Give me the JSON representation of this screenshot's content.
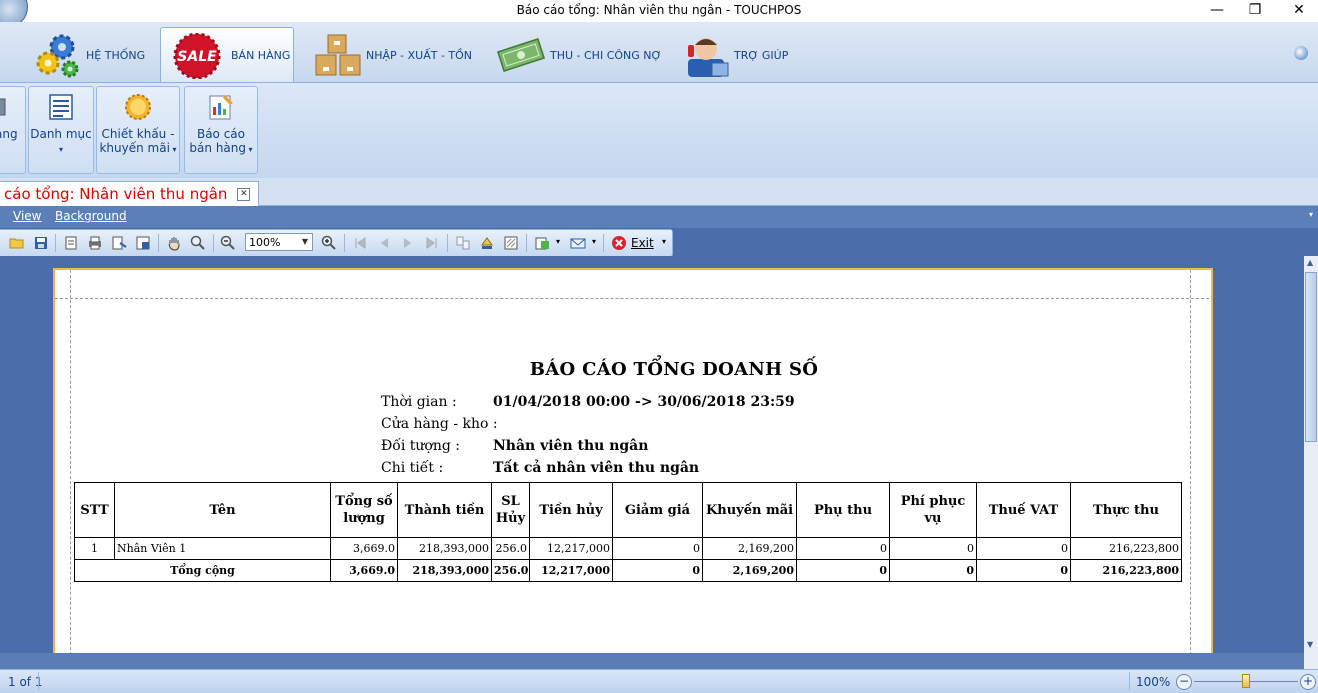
{
  "window": {
    "title": "Báo cáo tổng: Nhân viên thu ngân - TOUCHPOS",
    "minimize": "—",
    "maximize": "❐",
    "close": "✕"
  },
  "ribbon_tabs": [
    {
      "label": "HỆ THỐNG",
      "icon": "gears-icon"
    },
    {
      "label": "BÁN HÀNG",
      "icon": "sale-badge-icon",
      "badge": "SALE"
    },
    {
      "label": "NHẬP - XUẤT - TỒN",
      "icon": "boxes-icon"
    },
    {
      "label": "THU - CHI CÔNG NỢ",
      "icon": "money-icon"
    },
    {
      "label": "TRỢ GIÚP",
      "icon": "support-agent-icon"
    }
  ],
  "ribbon_groups": [
    {
      "label": "àng",
      "icon": "partial-icon"
    },
    {
      "label": "Danh mục",
      "icon": "list-icon"
    },
    {
      "label": "Chiết khấu - khuyến mãi",
      "line1": "Chiết khấu -",
      "line2": "khuyến mãi",
      "icon": "discount-icon"
    },
    {
      "label": "Báo cáo bán hàng",
      "line1": "Báo cáo",
      "line2": "bán hàng",
      "icon": "report-icon"
    }
  ],
  "doc_tab": {
    "label": "cáo tổng: Nhân viên thu ngân"
  },
  "menu": {
    "view": "View",
    "background": "Background"
  },
  "toolbar": {
    "zoom": "100%",
    "exit": "Exit"
  },
  "report": {
    "title": "BÁO CÁO TỔNG DOANH SỐ",
    "info": [
      {
        "label": "Thời gian :",
        "value": "01/04/2018 00:00 -> 30/06/2018 23:59"
      },
      {
        "label": "Cửa hàng - kho :",
        "value": ""
      },
      {
        "label": "Đối tượng :",
        "value": "Nhân viên thu ngân"
      },
      {
        "label": "Chi tiết :",
        "value": "Tất cả nhân viên thu ngân"
      }
    ],
    "columns": [
      "STT",
      "Tên",
      "Tổng số lượng",
      "Thành tiền",
      "SL Hủy",
      "Tiền hủy",
      "Giảm giá",
      "Khuyến mãi",
      "Phụ thu",
      "Phí phục vụ",
      "Thuế VAT",
      "Thực thu"
    ],
    "rows": [
      [
        "1",
        "Nhân Viên 1",
        "3,669.0",
        "218,393,000",
        "256.0",
        "12,217,000",
        "0",
        "2,169,200",
        "0",
        "0",
        "0",
        "216,223,800"
      ]
    ],
    "total": [
      "Tổng cộng",
      "3,669.0",
      "218,393,000",
      "256.0",
      "12,217,000",
      "0",
      "2,169,200",
      "0",
      "0",
      "0",
      "216,223,800"
    ]
  },
  "status": {
    "page": "1 of 1",
    "zoom": "100%",
    "zoom_level": 0.5
  }
}
